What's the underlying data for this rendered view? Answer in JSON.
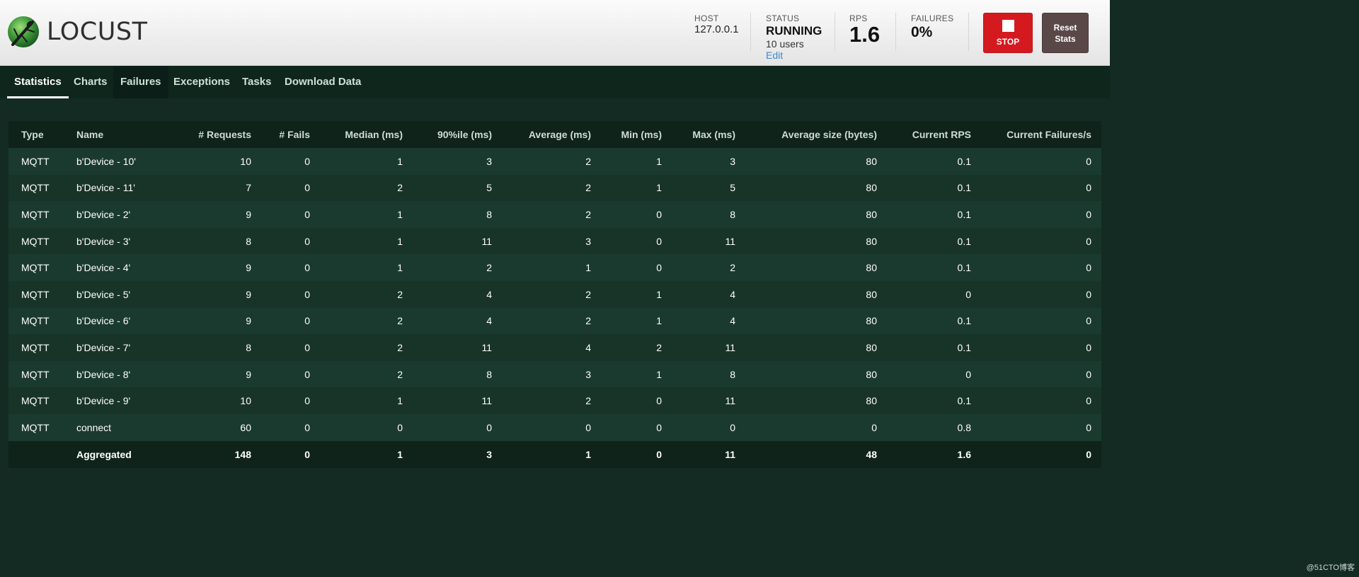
{
  "header": {
    "logo_text": "LOCUST",
    "host": {
      "label": "HOST",
      "value": "127.0.0.1"
    },
    "status": {
      "label": "STATUS",
      "value": "RUNNING",
      "users": "10 users",
      "edit": "Edit"
    },
    "rps": {
      "label": "RPS",
      "value": "1.6"
    },
    "failures": {
      "label": "FAILURES",
      "value": "0%"
    },
    "stop_label": "STOP",
    "reset_label_line1": "Reset",
    "reset_label_line2": "Stats"
  },
  "tabs": [
    {
      "label": "Statistics"
    },
    {
      "label": "Charts"
    },
    {
      "label": "Failures"
    },
    {
      "label": "Exceptions"
    },
    {
      "label": "Tasks"
    },
    {
      "label": "Download Data"
    }
  ],
  "table": {
    "columns": [
      "Type",
      "Name",
      "# Requests",
      "# Fails",
      "Median (ms)",
      "90%ile (ms)",
      "Average (ms)",
      "Min (ms)",
      "Max (ms)",
      "Average size (bytes)",
      "Current RPS",
      "Current Failures/s"
    ],
    "rows": [
      [
        "MQTT",
        "b'Device - 10'",
        "10",
        "0",
        "1",
        "3",
        "2",
        "1",
        "3",
        "80",
        "0.1",
        "0"
      ],
      [
        "MQTT",
        "b'Device - 11'",
        "7",
        "0",
        "2",
        "5",
        "2",
        "1",
        "5",
        "80",
        "0.1",
        "0"
      ],
      [
        "MQTT",
        "b'Device - 2'",
        "9",
        "0",
        "1",
        "8",
        "2",
        "0",
        "8",
        "80",
        "0.1",
        "0"
      ],
      [
        "MQTT",
        "b'Device - 3'",
        "8",
        "0",
        "1",
        "11",
        "3",
        "0",
        "11",
        "80",
        "0.1",
        "0"
      ],
      [
        "MQTT",
        "b'Device - 4'",
        "9",
        "0",
        "1",
        "2",
        "1",
        "0",
        "2",
        "80",
        "0.1",
        "0"
      ],
      [
        "MQTT",
        "b'Device - 5'",
        "9",
        "0",
        "2",
        "4",
        "2",
        "1",
        "4",
        "80",
        "0",
        "0"
      ],
      [
        "MQTT",
        "b'Device - 6'",
        "9",
        "0",
        "2",
        "4",
        "2",
        "1",
        "4",
        "80",
        "0.1",
        "0"
      ],
      [
        "MQTT",
        "b'Device - 7'",
        "8",
        "0",
        "2",
        "11",
        "4",
        "2",
        "11",
        "80",
        "0.1",
        "0"
      ],
      [
        "MQTT",
        "b'Device - 8'",
        "9",
        "0",
        "2",
        "8",
        "3",
        "1",
        "8",
        "80",
        "0",
        "0"
      ],
      [
        "MQTT",
        "b'Device - 9'",
        "10",
        "0",
        "1",
        "11",
        "2",
        "0",
        "11",
        "80",
        "0.1",
        "0"
      ],
      [
        "MQTT",
        "connect",
        "60",
        "0",
        "0",
        "0",
        "0",
        "0",
        "0",
        "0",
        "0.8",
        "0"
      ]
    ],
    "aggregated": [
      "",
      "Aggregated",
      "148",
      "0",
      "1",
      "3",
      "1",
      "0",
      "11",
      "48",
      "1.6",
      "0"
    ]
  },
  "watermark": "@51CTO博客"
}
